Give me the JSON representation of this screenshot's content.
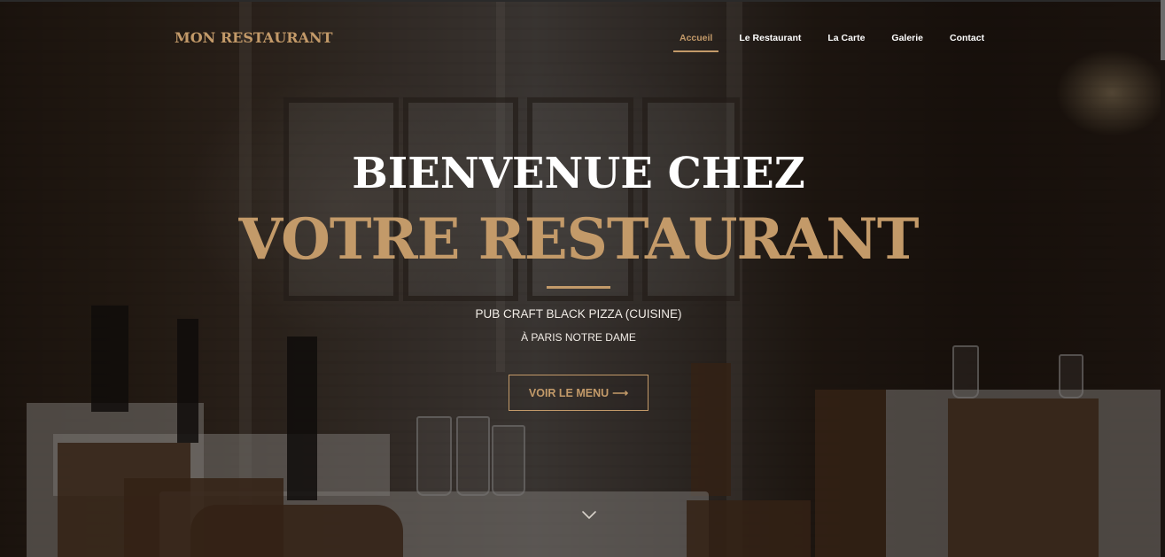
{
  "brand": {
    "name": "MON RESTAURANT",
    "accent_color": "#c39a69"
  },
  "nav": {
    "items": [
      {
        "label": "Accueil",
        "active": true
      },
      {
        "label": "Le Restaurant",
        "active": false
      },
      {
        "label": "La Carte",
        "active": false
      },
      {
        "label": "Galerie",
        "active": false
      },
      {
        "label": "Contact",
        "active": false
      }
    ]
  },
  "hero": {
    "line1": "BIENVENUE CHEZ",
    "line2": "VOTRE RESTAURANT",
    "subtitle": "PUB CRAFT BLACK PIZZA (CUISINE)",
    "location": "À PARIS NOTRE DAME",
    "cta_label": "VOIR LE MENU",
    "cta_arrow": "⟶",
    "scroll_icon": "chevron-down-icon"
  },
  "colors": {
    "text_light": "#ffffff",
    "overlay": "#0c0805"
  }
}
